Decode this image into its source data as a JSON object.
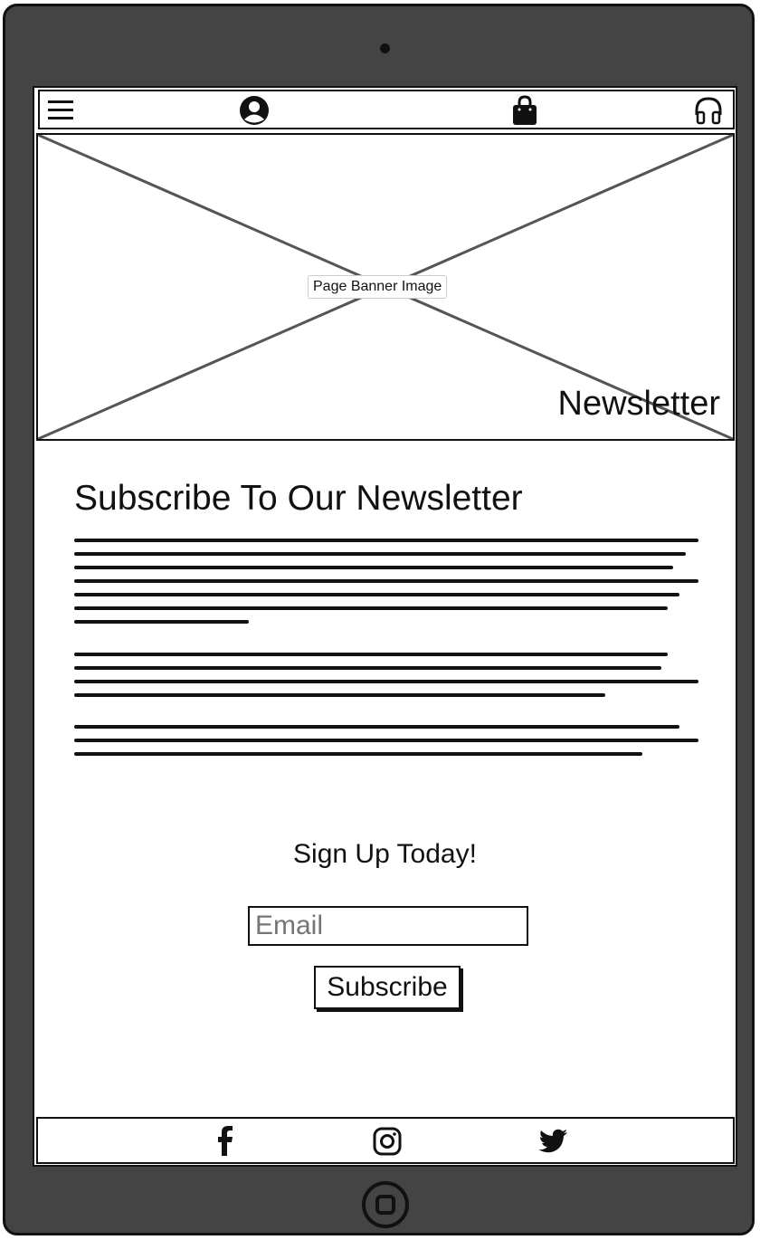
{
  "banner": {
    "image_label": "Page Banner Image",
    "title": "Newsletter"
  },
  "main": {
    "heading": "Subscribe To Our Newsletter"
  },
  "signup": {
    "title": "Sign Up Today!",
    "email_placeholder": "Email",
    "subscribe_label": "Subscribe"
  },
  "icons": {
    "nav": [
      "hamburger-menu-icon",
      "account-icon",
      "shopping-bag-icon",
      "headphones-icon"
    ],
    "social": [
      "facebook-icon",
      "instagram-icon",
      "twitter-icon"
    ]
  }
}
